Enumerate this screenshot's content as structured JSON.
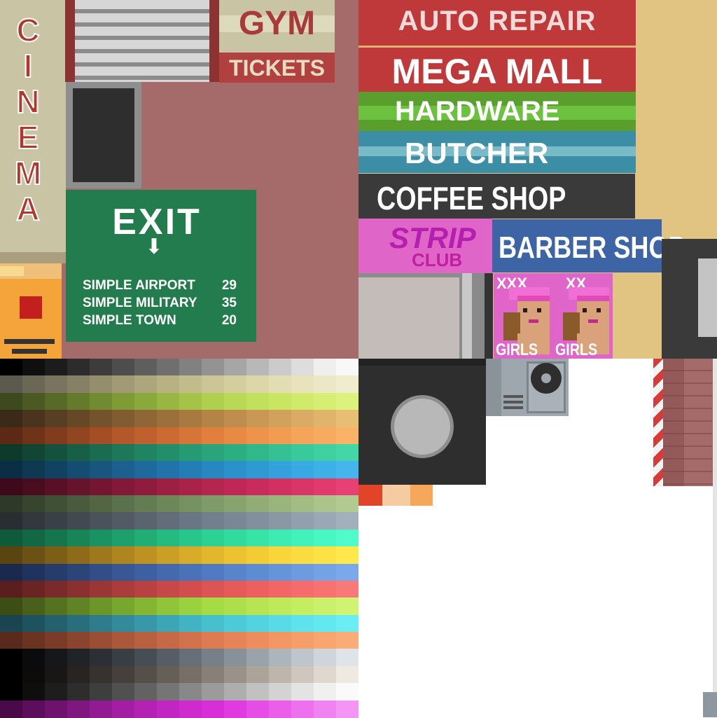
{
  "signs": {
    "cinema": [
      "C",
      "I",
      "N",
      "E",
      "M",
      "A"
    ],
    "gym": "GYM",
    "tickets": "TICKETS",
    "auto_repair": "AUTO REPAIR",
    "mega_mall": "MEGA MALL",
    "hardware": "HARDWARE",
    "butcher": "BUTCHER",
    "coffee_shop": "COFFEE SHOP",
    "strip": "STRIP",
    "club": "CLUB",
    "barber_shop": "BARBER SHOP",
    "poster_1": {
      "top": "XXX",
      "bottom": "GIRLS"
    },
    "poster_2": {
      "top": "XX",
      "bottom": "GIRLS"
    }
  },
  "exit_sign": {
    "title": "EXIT",
    "arrow": "⬇",
    "destinations": [
      {
        "name": "SIMPLE AIRPORT",
        "distance": "29"
      },
      {
        "name": "SIMPLE MILITARY",
        "distance": "35"
      },
      {
        "name": "SIMPLE TOWN",
        "distance": "20"
      }
    ]
  },
  "colors": {
    "brick_wall": "#a46b6a",
    "cinema_panel": "#c8c4a4",
    "sand": "#e2c482",
    "exit_green": "#237c4d",
    "auto_red": "#c0393a",
    "strip_pink": "#e065c9",
    "barber_blue": "#3d65a6",
    "coffee_dark": "#3a3a3a"
  },
  "palette": [
    [
      "#000000",
      "#0f0f0f",
      "#1c1c1c",
      "#2c2c2c",
      "#3c3c3c",
      "#4d4d4d",
      "#5e5e5e",
      "#6f6f6f",
      "#818181",
      "#939393",
      "#a6a6a6",
      "#b8b8b8",
      "#cbcbcb",
      "#dddddd",
      "#efefef",
      "#f8f8f8"
    ],
    [
      "#5c5a4e",
      "#6a6756",
      "#78745f",
      "#868166",
      "#948e6d",
      "#a19a74",
      "#ada67c",
      "#b8b183",
      "#c2bb8c",
      "#ccc596",
      "#d4ce9f",
      "#dcd6a9",
      "#e2ddb3",
      "#e8e3bd",
      "#ece8c6",
      "#f0edcf"
    ],
    [
      "#3d4a1e",
      "#4a5a22",
      "#576a27",
      "#647b2c",
      "#718b31",
      "#7e9b36",
      "#8aa93c",
      "#97b742",
      "#a3c448",
      "#aed04e",
      "#b8d955",
      "#c1e05c",
      "#c9e663",
      "#d0eb6a",
      "#d6ef72",
      "#dbf37a"
    ],
    [
      "#3c2a18",
      "#4a341d",
      "#583e22",
      "#664827",
      "#74522c",
      "#825c31",
      "#8f6636",
      "#9c703b",
      "#a87a41",
      "#b48447",
      "#bf8e4e",
      "#c99855",
      "#d2a25c",
      "#daab64",
      "#e1b46c",
      "#e8bd74"
    ],
    [
      "#5c2a14",
      "#6e3318",
      "#803c1c",
      "#924521",
      "#a44e25",
      "#b2582a",
      "#bf612e",
      "#cb6b33",
      "#d67538",
      "#e07f3e",
      "#e88944",
      "#ee934b",
      "#f29c52",
      "#f5a459",
      "#f7ab60",
      "#f9b267"
    ],
    [
      "#0e3a2c",
      "#114634",
      "#14523d",
      "#175f46",
      "#1a6b4f",
      "#1d7758",
      "#208361",
      "#238f6a",
      "#269a72",
      "#29a47b",
      "#2cae83",
      "#30b88b",
      "#35c193",
      "#3ac99a",
      "#3fd0a1",
      "#44d6a7"
    ],
    [
      "#0c2e44",
      "#0f3853",
      "#124262",
      "#154c71",
      "#185680",
      "#1b608f",
      "#1e6a9d",
      "#2174aa",
      "#247eb6",
      "#2788c1",
      "#2a91cb",
      "#2e9ad4",
      "#33a2dc",
      "#38a9e2",
      "#3eb0e8",
      "#44b6ed"
    ],
    [
      "#3c0a1a",
      "#4a0d20",
      "#581026",
      "#66132c",
      "#741632",
      "#821938",
      "#8f1c3e",
      "#9c1f44",
      "#a8224a",
      "#b42550",
      "#bf2856",
      "#c92c5c",
      "#d23062",
      "#da3568",
      "#e13a6e",
      "#e74074"
    ],
    [
      "#2e3a28",
      "#37452f",
      "#405036",
      "#495b3d",
      "#526644",
      "#5b714b",
      "#647c52",
      "#6d8759",
      "#769160",
      "#7f9b67",
      "#88a46e",
      "#91ad75",
      "#9ab57c",
      "#a2bd83",
      "#aac48a",
      "#b1ca91"
    ],
    [
      "#2a2e33",
      "#32373d",
      "#3a4047",
      "#424951",
      "#4a525b",
      "#525b65",
      "#5a646f",
      "#626d79",
      "#6a7683",
      "#727f8c",
      "#7a8895",
      "#82909e",
      "#8a98a6",
      "#92a0ae",
      "#9aa8b5",
      "#a2afbc"
    ],
    [
      "#0f5a3a",
      "#126844",
      "#15764e",
      "#188458",
      "#1b9262",
      "#1ea06c",
      "#21ad76",
      "#24ba80",
      "#28c68a",
      "#2cd194",
      "#31db9e",
      "#37e4a8",
      "#3decb2",
      "#43f2bb",
      "#49f7c3",
      "#4ffbcb"
    ],
    [
      "#5a4410",
      "#6b5113",
      "#7c5e16",
      "#8d6b19",
      "#9e781c",
      "#ae851f",
      "#bd9222",
      "#cb9f25",
      "#d8ab28",
      "#e3b72c",
      "#ecc230",
      "#f3cc35",
      "#f8d53a",
      "#fbdc40",
      "#fde246",
      "#fee84c"
    ],
    [
      "#1a2a4e",
      "#20335c",
      "#263c6a",
      "#2c4578",
      "#324e86",
      "#385794",
      "#3e60a1",
      "#4469ad",
      "#4a72b8",
      "#507bc2",
      "#5784cb",
      "#5e8cd3",
      "#6594da",
      "#6c9be0",
      "#73a2e5",
      "#7aa8ea"
    ],
    [
      "#5a1e1e",
      "#6a2424",
      "#7a2a2a",
      "#8a3030",
      "#9a3636",
      "#aa3c3c",
      "#b84242",
      "#c64848",
      "#d24e4e",
      "#dd5454",
      "#e65a5a",
      "#ed6060",
      "#f26666",
      "#f66c6c",
      "#f87272",
      "#f97878"
    ],
    [
      "#3c4e16",
      "#48601b",
      "#547220",
      "#608425",
      "#6c962a",
      "#78a72f",
      "#84b634",
      "#90c439",
      "#9ad13e",
      "#a4dc43",
      "#addf4a",
      "#b6e452",
      "#bee95a",
      "#c5ed62",
      "#cbf06a",
      "#d0f372"
    ],
    [
      "#1a4450",
      "#1f525f",
      "#24606e",
      "#296e7d",
      "#2e7c8c",
      "#338a9b",
      "#3898a9",
      "#3da6b6",
      "#42b3c2",
      "#47bfcd",
      "#4ccad7",
      "#52d3df",
      "#58dbe6",
      "#5ee2eb",
      "#64e8f0",
      "#6aedf4"
    ],
    [
      "#5a2a1c",
      "#6a3322",
      "#7a3c28",
      "#8a452e",
      "#9a4e34",
      "#aa573a",
      "#b86040",
      "#c66946",
      "#d2724c",
      "#dd7b52",
      "#e68458",
      "#ed8d5e",
      "#f29664",
      "#f69e6a",
      "#f8a570",
      "#f9ac76"
    ],
    [
      "#000000",
      "#0a0b0c",
      "#15171a",
      "#202328",
      "#2c3036",
      "#393e45",
      "#474d55",
      "#565d66",
      "#666e77",
      "#778089",
      "#88919a",
      "#9aa3ab",
      "#acb4bc",
      "#bec5cc",
      "#cfd5db",
      "#dfe4e8"
    ],
    [
      "#000000",
      "#0c0b0a",
      "#191715",
      "#272421",
      "#36322e",
      "#45403b",
      "#554f49",
      "#665f58",
      "#776f67",
      "#888077",
      "#9a9188",
      "#aca399",
      "#beb5ab",
      "#cfc7bd",
      "#dfd8cf",
      "#eee9e1"
    ],
    [
      "#000000",
      "#0e0e0e",
      "#1d1d1d",
      "#2d2d2d",
      "#3e3e3e",
      "#505050",
      "#626262",
      "#757575",
      "#888888",
      "#9b9b9b",
      "#aeaeae",
      "#c1c1c1",
      "#d3d3d3",
      "#e3e3e3",
      "#f0f0f0",
      "#fafafa"
    ],
    [
      "#4a0a4a",
      "#5c0e5c",
      "#6e126e",
      "#801680",
      "#921a92",
      "#a41ea4",
      "#b422b4",
      "#c226c2",
      "#ce2ace",
      "#d82ed8",
      "#e03ae0",
      "#e64ce6",
      "#ea5eea",
      "#ee70ee",
      "#f182f1",
      "#f494f4"
    ]
  ]
}
